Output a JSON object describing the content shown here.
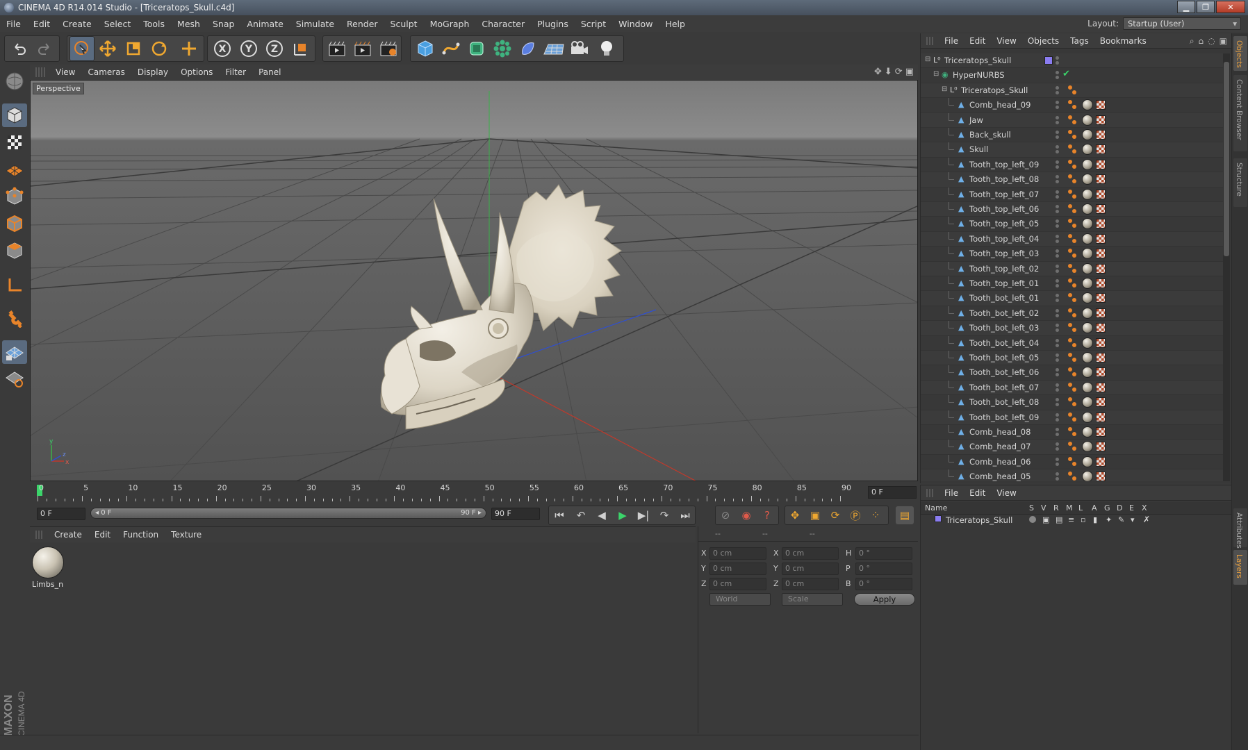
{
  "window": {
    "title": "CINEMA 4D R14.014 Studio - [Triceratops_Skull.c4d]",
    "buttons": [
      "▁",
      "❐",
      "✕"
    ]
  },
  "menubar": [
    "File",
    "Edit",
    "Create",
    "Select",
    "Tools",
    "Mesh",
    "Snap",
    "Animate",
    "Simulate",
    "Render",
    "Sculpt",
    "MoGraph",
    "Character",
    "Plugins",
    "Script",
    "Window",
    "Help"
  ],
  "layout": {
    "label": "Layout:",
    "value": "Startup (User)"
  },
  "toolbar": {
    "icons": [
      "undo-icon",
      "redo-icon",
      "live-selection-icon",
      "move-icon",
      "scale-icon",
      "rotate-icon",
      "add-icon",
      "x-axis-icon",
      "y-axis-icon",
      "z-axis-icon",
      "coordinate-system-icon",
      "render-view-icon",
      "render-picture-viewer-icon",
      "edit-render-settings-icon",
      "cube-icon",
      "spline-icon",
      "nurbs-icon",
      "array-icon",
      "deformer-icon",
      "floor-icon",
      "camera-icon",
      "light-icon"
    ],
    "axis_labels": [
      "X",
      "Y",
      "Z"
    ]
  },
  "lefttools": [
    "make-editable-icon",
    "model-mode-icon",
    "texture-mode-icon",
    "workplane-icon",
    "points-mode-icon",
    "edges-mode-icon",
    "polygons-mode-icon",
    "axis-icon",
    "magnet-icon",
    "snap-icon",
    "locked-workplane-icon"
  ],
  "maxon": {
    "brand": "MAXON",
    "product": "CINEMA 4D"
  },
  "viewport": {
    "menu": [
      "View",
      "Cameras",
      "Display",
      "Options",
      "Filter",
      "Panel"
    ],
    "label": "Perspective",
    "nav_icons": [
      "✥",
      "⬇",
      "⟳",
      "▣"
    ],
    "axis_x": "x",
    "axis_y": "y",
    "axis_z": "z"
  },
  "timeline": {
    "ticks": [
      "0",
      "5",
      "10",
      "15",
      "20",
      "25",
      "30",
      "35",
      "40",
      "45",
      "50",
      "55",
      "60",
      "65",
      "70",
      "75",
      "80",
      "85",
      "90"
    ],
    "current_frame": "0 F"
  },
  "transport": {
    "start": "0 F",
    "slider_left": "◂ 0 F",
    "slider_right": "90 F ▸",
    "end": "90 F",
    "buttons": [
      "go-to-start-icon",
      "previous-key-icon",
      "previous-frame-icon",
      "play-icon",
      "next-frame-icon",
      "next-key-icon",
      "go-to-end-icon",
      "record-icon",
      "autokey-icon",
      "help-icon",
      "move-key-icon",
      "scale-key-icon",
      "rotate-key-icon",
      "param-key-icon",
      "pla-key-icon",
      "timeline-icon"
    ]
  },
  "material_manager": {
    "menu": [
      "Create",
      "Edit",
      "Function",
      "Texture"
    ],
    "materials": [
      {
        "name": "Limbs_n"
      }
    ]
  },
  "coordinates": {
    "headers": [
      "--",
      "--",
      "--"
    ],
    "rows": [
      {
        "a": "X",
        "av": "0 cm",
        "b": "X",
        "bv": "0 cm",
        "c": "H",
        "cv": "0 °"
      },
      {
        "a": "Y",
        "av": "0 cm",
        "b": "Y",
        "bv": "0 cm",
        "c": "P",
        "cv": "0 °"
      },
      {
        "a": "Z",
        "av": "0 cm",
        "b": "Z",
        "bv": "0 cm",
        "c": "B",
        "cv": "0 °"
      }
    ],
    "space": "World",
    "mode": "Scale",
    "apply": "Apply"
  },
  "object_manager": {
    "menu": [
      "File",
      "Edit",
      "View",
      "Objects",
      "Tags",
      "Bookmarks"
    ],
    "header_icons": [
      "⌕",
      "⌂",
      "◌",
      "▣"
    ],
    "objects": [
      {
        "name": "Triceratops_Skull",
        "depth": 0,
        "type": "null"
      },
      {
        "name": "HyperNURBS",
        "depth": 1,
        "type": "hypernurbs"
      },
      {
        "name": "Triceratops_Skull",
        "depth": 2,
        "type": "null"
      },
      {
        "name": "Comb_head_09",
        "depth": 3,
        "type": "mesh"
      },
      {
        "name": "Jaw",
        "depth": 3,
        "type": "mesh"
      },
      {
        "name": "Back_skull",
        "depth": 3,
        "type": "mesh"
      },
      {
        "name": "Skull",
        "depth": 3,
        "type": "mesh"
      },
      {
        "name": "Tooth_top_left_09",
        "depth": 3,
        "type": "mesh"
      },
      {
        "name": "Tooth_top_left_08",
        "depth": 3,
        "type": "mesh"
      },
      {
        "name": "Tooth_top_left_07",
        "depth": 3,
        "type": "mesh"
      },
      {
        "name": "Tooth_top_left_06",
        "depth": 3,
        "type": "mesh"
      },
      {
        "name": "Tooth_top_left_05",
        "depth": 3,
        "type": "mesh"
      },
      {
        "name": "Tooth_top_left_04",
        "depth": 3,
        "type": "mesh"
      },
      {
        "name": "Tooth_top_left_03",
        "depth": 3,
        "type": "mesh"
      },
      {
        "name": "Tooth_top_left_02",
        "depth": 3,
        "type": "mesh"
      },
      {
        "name": "Tooth_top_left_01",
        "depth": 3,
        "type": "mesh"
      },
      {
        "name": "Tooth_bot_left_01",
        "depth": 3,
        "type": "mesh"
      },
      {
        "name": "Tooth_bot_left_02",
        "depth": 3,
        "type": "mesh"
      },
      {
        "name": "Tooth_bot_left_03",
        "depth": 3,
        "type": "mesh"
      },
      {
        "name": "Tooth_bot_left_04",
        "depth": 3,
        "type": "mesh"
      },
      {
        "name": "Tooth_bot_left_05",
        "depth": 3,
        "type": "mesh"
      },
      {
        "name": "Tooth_bot_left_06",
        "depth": 3,
        "type": "mesh"
      },
      {
        "name": "Tooth_bot_left_07",
        "depth": 3,
        "type": "mesh"
      },
      {
        "name": "Tooth_bot_left_08",
        "depth": 3,
        "type": "mesh"
      },
      {
        "name": "Tooth_bot_left_09",
        "depth": 3,
        "type": "mesh"
      },
      {
        "name": "Comb_head_08",
        "depth": 3,
        "type": "mesh"
      },
      {
        "name": "Comb_head_07",
        "depth": 3,
        "type": "mesh"
      },
      {
        "name": "Comb_head_06",
        "depth": 3,
        "type": "mesh"
      },
      {
        "name": "Comb_head_05",
        "depth": 3,
        "type": "mesh"
      }
    ]
  },
  "layer_manager": {
    "menu": [
      "File",
      "Edit",
      "View"
    ],
    "columns": [
      "Name",
      "S",
      "V",
      "R",
      "M",
      "L",
      "A",
      "G",
      "D",
      "E",
      "X"
    ],
    "layers": [
      {
        "name": "Triceratops_Skull",
        "color": "#8a7cf0"
      }
    ]
  },
  "side_tabs": [
    {
      "label": "Objects",
      "active": true
    },
    {
      "label": "Content Browser",
      "active": false
    },
    {
      "label": "Structure",
      "active": false
    },
    {
      "label": "Attributes",
      "active": false
    },
    {
      "label": "Layers",
      "active": true
    }
  ],
  "colors": {
    "active_tool": "#5a6b80",
    "accent_orange": "#e8a040",
    "playhead": "#3bd46a",
    "viewport_bg": "#5a5a5a",
    "skull": "#e6e1d5"
  }
}
